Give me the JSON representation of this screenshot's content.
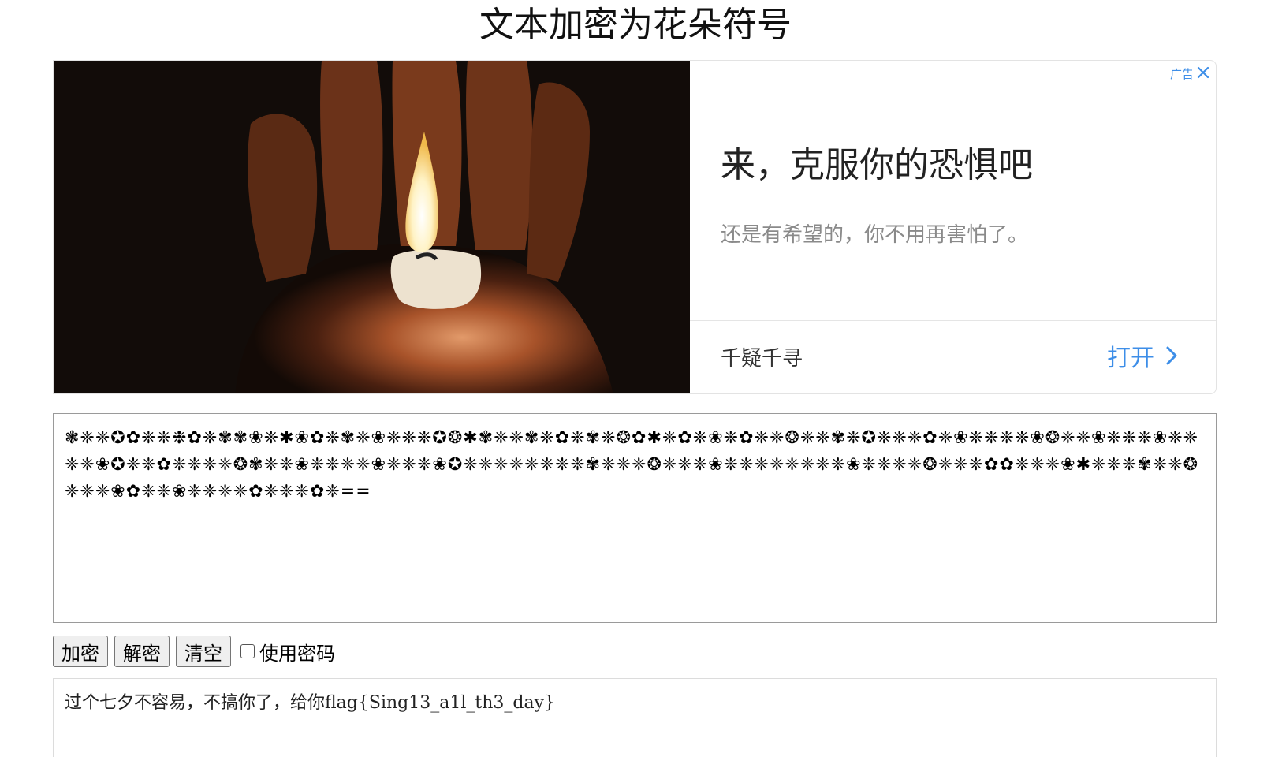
{
  "page": {
    "title": "文本加密为花朵符号"
  },
  "ad": {
    "badge": "广告",
    "headline": "来，克服你的恐惧吧",
    "description": "还是有希望的，你不用再害怕了。",
    "brand": "千疑千寻",
    "open_label": "打开",
    "accent_color": "#3d8ee8"
  },
  "cipher_box": {
    "value": "❃❈❈✪✿❈❈❉✿❈✾✾❀❈✱❀✿❈✾❈❀❈❈❈✪❂✱✾❈❈✾❈✿❈✾❈❂✿✱❈✿❈❀❈✿❈❈❂❈❈✾❈✪❈❈❈✿❈❀❈❈❈❈❀❂❈❈❀❈❈❈❀❈❈❈❈❀✪❈❈✿❈❈❈❈❂✾❈❈❀❈❈❈❈❀❈❈❈❀✪❈❈❈❈❈❈❈❈✾❈❈❈❂❈❈❈❀❈❈❈❈❈❈❈❈❀❈❈❈❈❂❈❈❈✿✿❈❈❈❀✱❈❈❈✾❈❈❂❈❈❈❀✿❈❈❀❈❈❈❈✿❈❈❈✿❈=="
  },
  "controls": {
    "encrypt_label": "加密",
    "decrypt_label": "解密",
    "clear_label": "清空",
    "use_password_label": "使用密码",
    "use_password_checked": false
  },
  "plain_box": {
    "value": "过个七夕不容易，不搞你了，给你flag{Sing13_a1l_th3_day}"
  }
}
